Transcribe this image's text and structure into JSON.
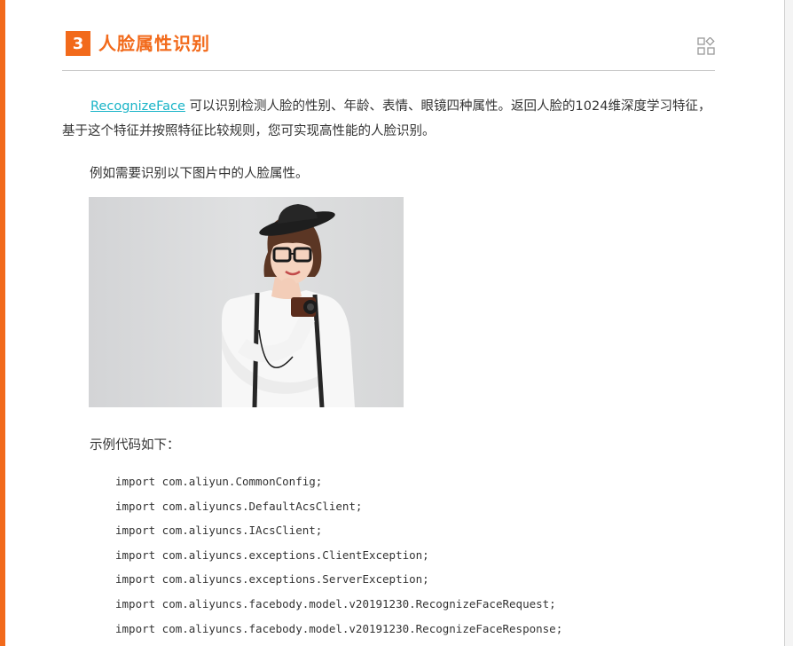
{
  "section": {
    "number": "3",
    "title": "人脸属性识别"
  },
  "paragraph": {
    "link_text": "RecognizeFace",
    "text": " 可以识别检测人脸的性别、年龄、表情、眼镜四种属性。返回人脸的1024维深度学习特征，基于这个特征并按照特征比较规则，您可实现高性能的人脸识别。"
  },
  "example_intro": "例如需要识别以下图片中的人脸属性。",
  "code_intro": "示例代码如下：",
  "code_lines": [
    "import com.aliyun.CommonConfig;",
    "import com.aliyuncs.DefaultAcsClient;",
    "import com.aliyuncs.IAcsClient;",
    "import com.aliyuncs.exceptions.ClientException;",
    "import com.aliyuncs.exceptions.ServerException;",
    "import com.aliyuncs.facebody.model.v20191230.RecognizeFaceRequest;",
    "import com.aliyuncs.facebody.model.v20191230.RecognizeFaceResponse;"
  ],
  "icons": {
    "category": "category-icon"
  },
  "colors": {
    "accent": "#f26a1b",
    "link": "#18b4c7"
  }
}
